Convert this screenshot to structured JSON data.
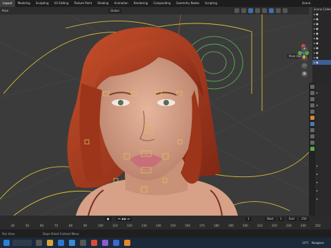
{
  "topbar": {
    "workspace_tabs": [
      "Layout",
      "Modeling",
      "Sculpting",
      "UV Editing",
      "Texture Paint",
      "Shading",
      "Animation",
      "Rendering",
      "Compositing",
      "Geometry Nodes",
      "Scripting"
    ],
    "scene_label": "Scene"
  },
  "header": {
    "mode": "Pose",
    "orientation": "Global"
  },
  "viewport": {
    "pose_options": "Pose Options"
  },
  "outliner": {
    "title": "Scene Collection"
  },
  "timeline": {
    "frame_numbers": [
      "40",
      "50",
      "60",
      "70",
      "80",
      "90",
      "100",
      "110",
      "120",
      "130",
      "140",
      "150",
      "160",
      "170",
      "180",
      "190",
      "200",
      "210",
      "220",
      "230",
      "240",
      "250"
    ],
    "current_frame": "1",
    "start_label": "Start",
    "start_value": "1",
    "end_label": "End",
    "end_value": "250"
  },
  "statusbar": {
    "pan_view": "Pan View",
    "context_menu": "Dope Sheet Context Menu"
  },
  "taskbar": {
    "temperature": "14°C",
    "weather": "Nuageux"
  },
  "colors": {
    "accent": "#4772b3",
    "bone_yellow": "#d8c23a",
    "bone_green": "#58a84a",
    "hair": "#b3401f",
    "skin": "#d8a48a"
  }
}
